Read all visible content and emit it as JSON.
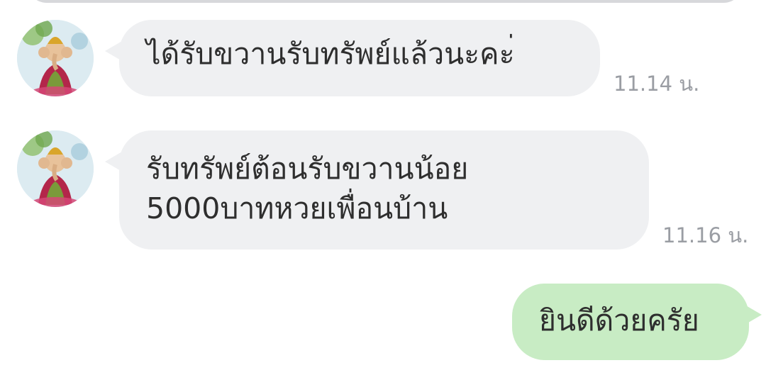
{
  "messages": [
    {
      "direction": "incoming",
      "avatar_icon": "ganesha-avatar-icon",
      "lines": [
        "ได้รับขวานรับทรัพย์แล้วนะคะ่"
      ],
      "time": "11.14 น."
    },
    {
      "direction": "incoming",
      "avatar_icon": "ganesha-avatar-icon",
      "lines": [
        "รับทรัพย์ต้อนรับขวานน้อย",
        "5000บาทหวยเพื่อนบ้าน"
      ],
      "time": "11.16 น."
    },
    {
      "direction": "outgoing",
      "lines": [
        "ยินดีด้วยครัย"
      ]
    }
  ],
  "colors": {
    "incoming_bubble": "#eff0f2",
    "outgoing_bubble": "#c8ecc4",
    "timestamp": "#9a9da3"
  }
}
